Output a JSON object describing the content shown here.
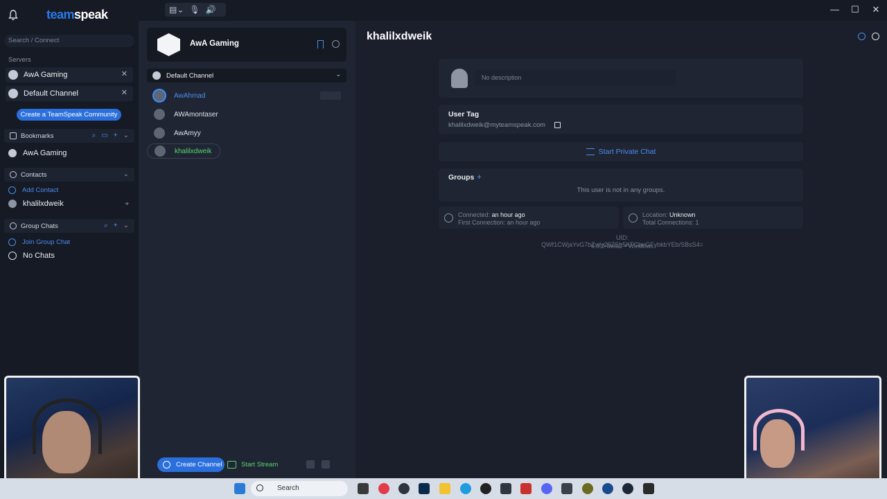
{
  "app": {
    "logo_part1": "team",
    "logo_part2": "speak"
  },
  "titlebar": {
    "window_buttons": [
      "—",
      "☐",
      "✕"
    ]
  },
  "sidebar": {
    "search_placeholder": "Search / Connect",
    "servers_label": "Servers",
    "server_items": [
      {
        "name": "AwA Gaming",
        "icon": "server-hex-icon"
      },
      {
        "name": "Default Channel",
        "icon": "channel-hex-icon"
      }
    ],
    "cta_label": "Create a TeamSpeak Community",
    "bookmarks": {
      "title": "Bookmarks",
      "items": [
        "AwA Gaming"
      ]
    },
    "contacts": {
      "title": "Contacts",
      "add_label": "Add Contact",
      "items": [
        "khalilxdweik"
      ]
    },
    "group_chats": {
      "title": "Group Chats",
      "join_label": "Join Group Chat",
      "empty_label": "No Chats"
    }
  },
  "channel_panel": {
    "server_name": "AwA Gaming",
    "channel_name": "Default Channel",
    "users": [
      "AwAhmad",
      "AWAmontaser",
      "AwAmyy",
      "khalilxdweik"
    ],
    "create_channel_label": "Create Channel",
    "start_stream_label": "Start Stream"
  },
  "profile": {
    "username": "khalilxdweik",
    "description_placeholder": "No description",
    "user_tag_label": "User Tag",
    "user_tag_value": "khalilxdweik@myteamspeak.com",
    "private_chat_label": "Start Private Chat",
    "groups_label": "Groups",
    "groups_empty": "This user is not in any groups.",
    "connected_label": "Connected:",
    "connected_value": "an hour ago",
    "first_connection": "First Connection: an hour ago",
    "location_label": "Location:",
    "location_value": "Unknown",
    "total_connections": "Total Connections: 1",
    "uid": "UID: QWf1CWjaYvG7bZwly29ZSb5KFCbeGFybkbYEb/SBsS4=",
    "version": "6.0.0-beta2 • Windows"
  },
  "taskbar": {
    "search_label": "Search"
  },
  "colors": {
    "accent": "#2a6fdb",
    "link": "#4d8ef0",
    "self_user": "#5ad76f",
    "background": "#171c27"
  }
}
